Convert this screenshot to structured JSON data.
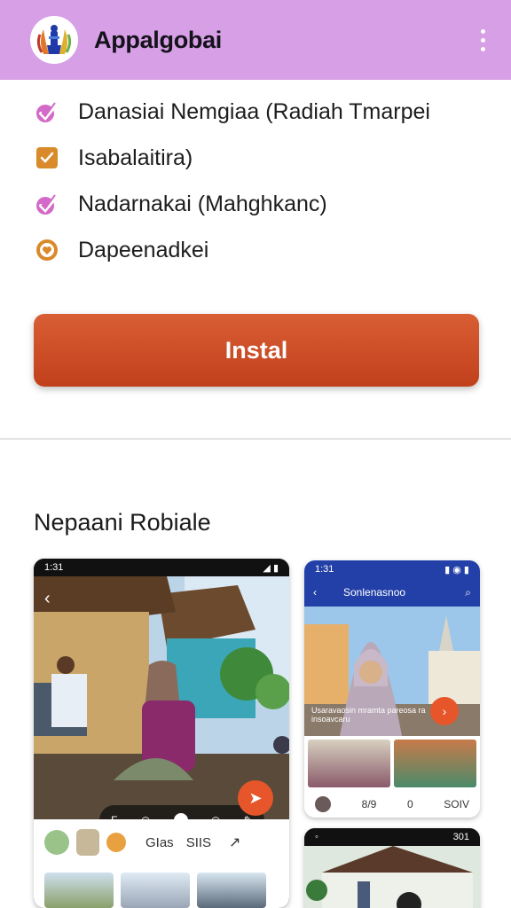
{
  "header": {
    "app_title": "Appalgobai",
    "logo_icon": "app-logo-emblem",
    "menu_icon": "kebab-menu-icon"
  },
  "features": [
    {
      "icon": "check-icon",
      "color": "#d36ac8",
      "label": "Danasiai Nemgiaa (Radiah Tmarpei"
    },
    {
      "icon": "check-box-icon",
      "color": "#d98a2a",
      "label": "Isabalaitira)"
    },
    {
      "icon": "check-icon",
      "color": "#d36ac8",
      "label": "Nadarnakai (Mahghkanc)"
    },
    {
      "icon": "shield-heart-icon",
      "color": "#d98a2a",
      "label": "Dapeenadkei"
    }
  ],
  "install_label": "Instal",
  "section_title": "Nepaani Robiale",
  "screenshots": {
    "s1": {
      "status_time": "1:31",
      "controls": [
        "F",
        "◎",
        "◎",
        "✎"
      ],
      "stats": [
        "GIas",
        "SIIS"
      ]
    },
    "s2": {
      "status_time": "1:31",
      "nav_title": "Sonlenasnoo",
      "caption": "Usaravaosin mramta pareosa ra insoavcaru",
      "footer": [
        "8/9",
        "0",
        "SOIV"
      ]
    },
    "s3": {
      "status_time": "301"
    }
  },
  "colors": {
    "header_bg": "#d79fe6",
    "install_bg": "#cf4f24",
    "accent_orange": "#e6562a",
    "nav_blue": "#2240a8"
  }
}
